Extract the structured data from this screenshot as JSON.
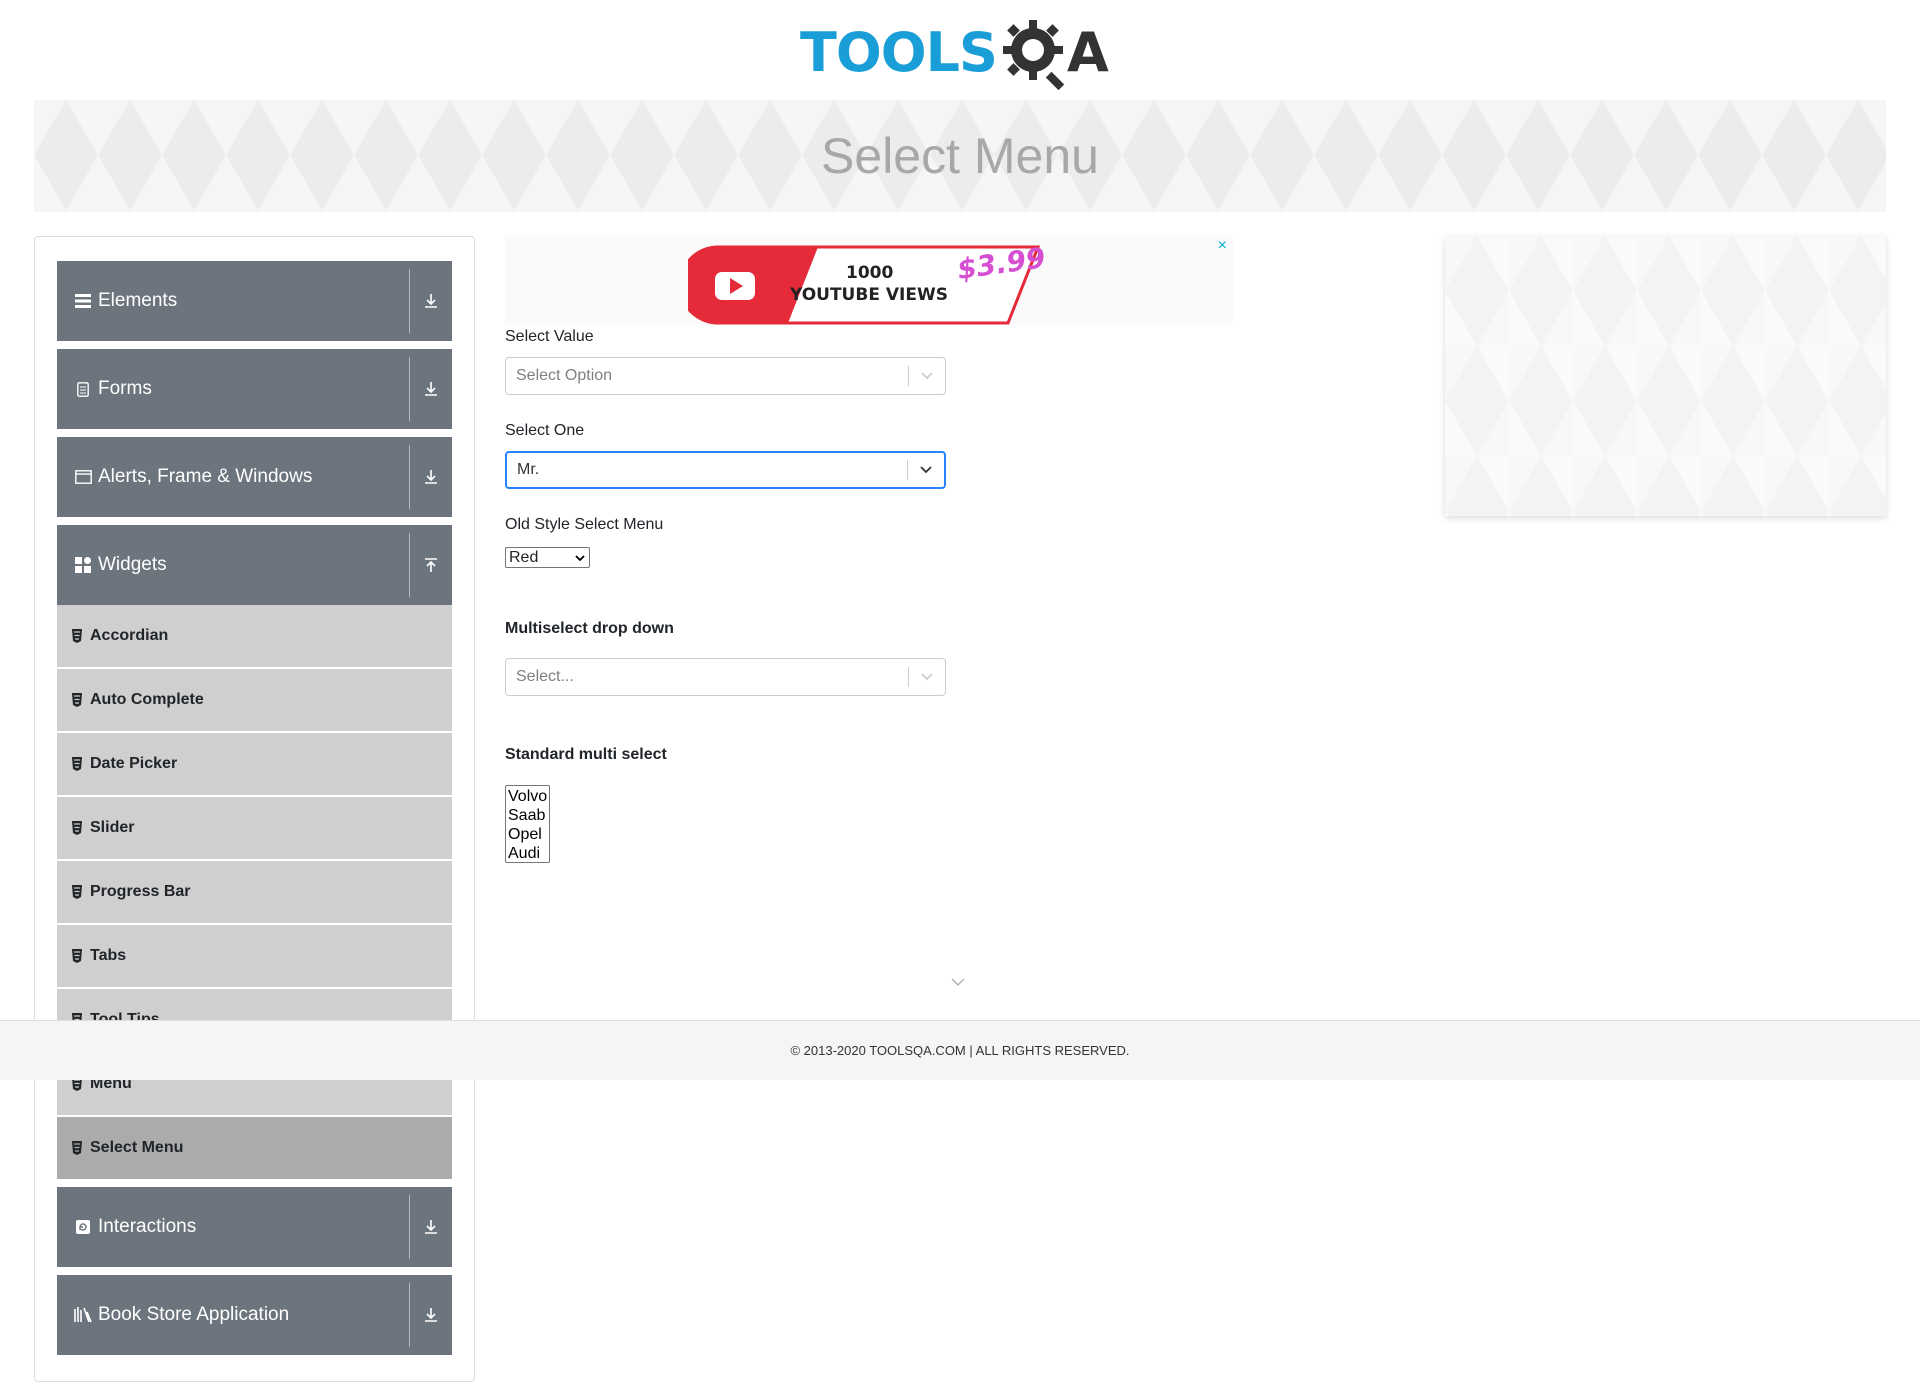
{
  "logo": {
    "tools": "TOOLS",
    "q": "Q",
    "a": "A"
  },
  "banner": {
    "title": "Select Menu"
  },
  "sidebar": {
    "groups": [
      {
        "label": "Elements",
        "icon": "hamburger-icon",
        "expanded": false
      },
      {
        "label": "Forms",
        "icon": "document-icon",
        "expanded": false
      },
      {
        "label": "Alerts, Frame & Windows",
        "icon": "window-icon",
        "expanded": false
      },
      {
        "label": "Widgets",
        "icon": "grid-icon",
        "expanded": true
      },
      {
        "label": "Interactions",
        "icon": "interact-icon",
        "expanded": false
      },
      {
        "label": "Book Store Application",
        "icon": "books-icon",
        "expanded": false
      }
    ],
    "widget_items": [
      "Accordian",
      "Auto Complete",
      "Date Picker",
      "Slider",
      "Progress Bar",
      "Tabs",
      "Tool Tips",
      "Menu",
      "Select Menu"
    ],
    "active_item": "Select Menu"
  },
  "ad": {
    "line1": "1000",
    "line2": "YOUTUBE VIEWS",
    "price": "$3.99",
    "close": "×"
  },
  "form": {
    "select_value": {
      "label": "Select Value",
      "placeholder": "Select Option"
    },
    "select_one": {
      "label": "Select One",
      "value": "Mr."
    },
    "old_style": {
      "label": "Old Style Select Menu",
      "value": "Red"
    },
    "multiselect": {
      "label": "Multiselect drop down",
      "placeholder": "Select..."
    },
    "standard_multi": {
      "label": "Standard multi select",
      "options": [
        "Volvo",
        "Saab",
        "Opel",
        "Audi"
      ]
    }
  },
  "footer": {
    "text": "© 2013-2020 TOOLSQA.COM | ALL RIGHTS RESERVED."
  },
  "colors": {
    "accent": "#1a9ed8",
    "sidebar_header": "#6c757d",
    "sub_item": "#cfcfcf",
    "active_item": "#ababab",
    "focus": "#2684ff"
  }
}
